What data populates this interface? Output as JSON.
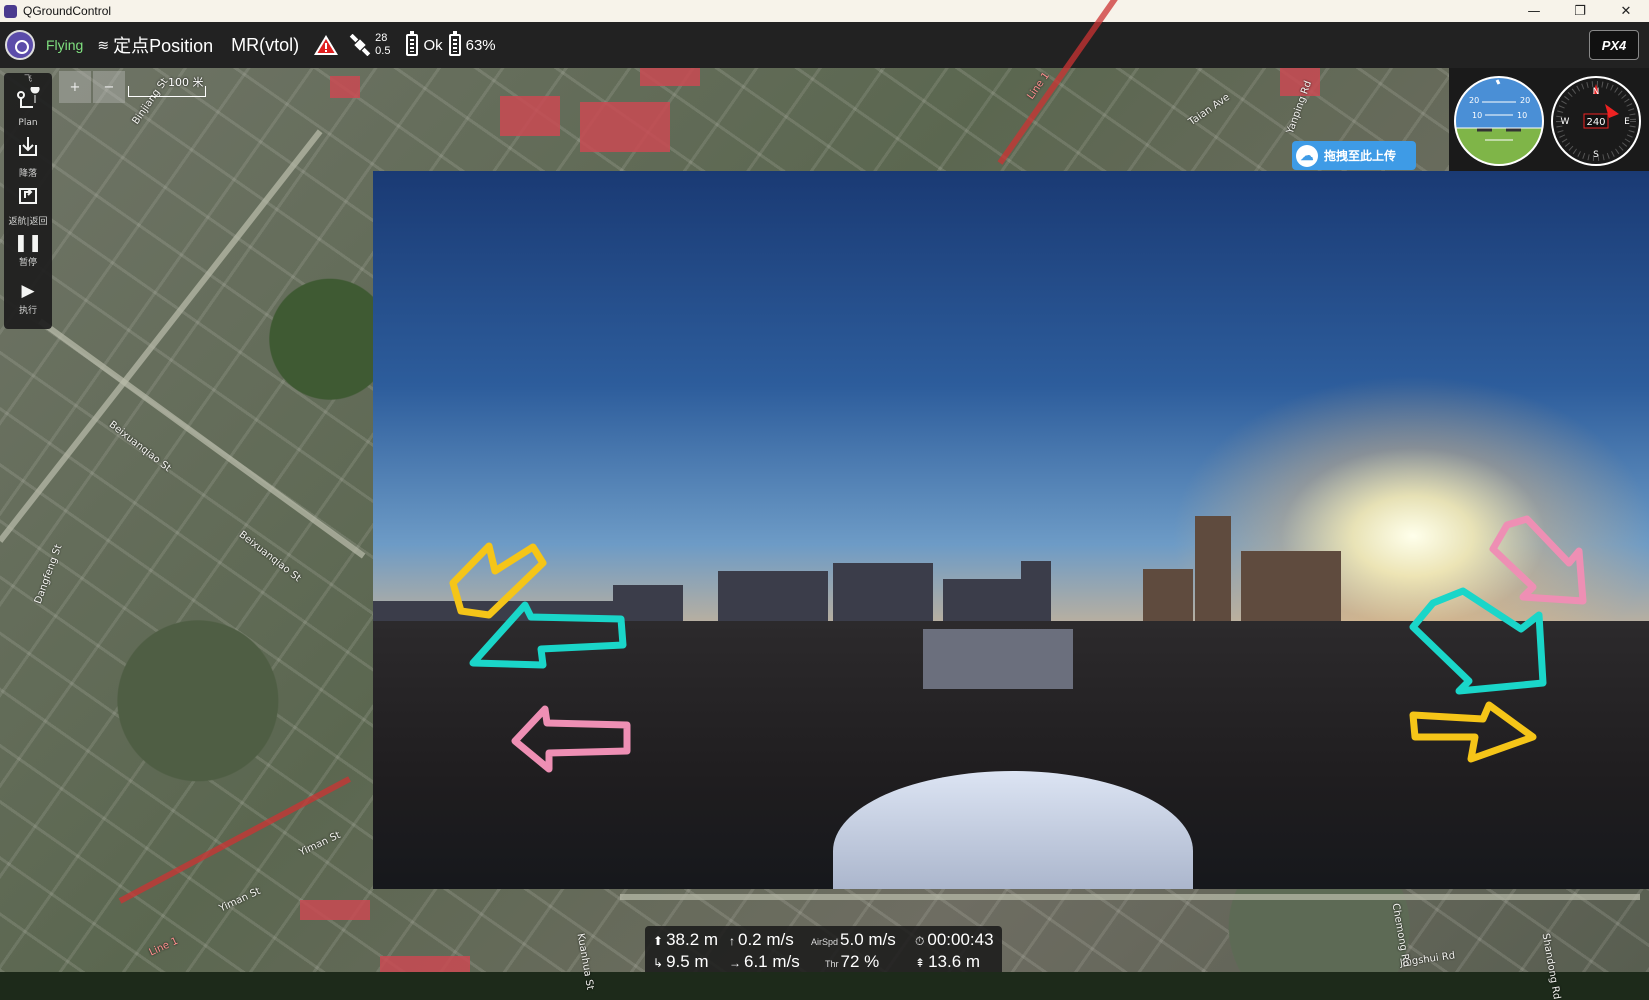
{
  "window": {
    "title": "QGroundControl",
    "minimize": "—",
    "restore": "❐",
    "close": "✕"
  },
  "toolbar": {
    "flight_state": "Flying",
    "flight_mode_icon": "signal-bars-icon",
    "flight_mode": "定点Position",
    "vehicle_type": "MR(vtol)",
    "gps_satellites": "28",
    "gps_hdop": "0.5",
    "status_ok": "Ok",
    "battery": "63%",
    "brand_logo": "PX4"
  },
  "fly_tools": {
    "header": "飞",
    "items": [
      {
        "icon": "plan-icon",
        "label": "Plan"
      },
      {
        "icon": "land-icon",
        "label": "降落"
      },
      {
        "icon": "rtl-icon",
        "label": "返航|返回"
      },
      {
        "icon": "pause-icon",
        "label": "暂停"
      },
      {
        "icon": "play-icon",
        "label": "执行"
      }
    ]
  },
  "map": {
    "scale_label": "100 米",
    "zoom_in": "+",
    "zoom_out": "−",
    "street_labels": [
      "Binjiang St",
      "Beixuanqiao St",
      "Beixuanqiao St",
      "Taian Ave",
      "Yanping Rd",
      "Yiman St",
      "Yiman St",
      "Dangfeng St",
      "Kuanhua St",
      "Jingshui Rd",
      "Line 1",
      "Line 1",
      "Shandong Rd",
      "Chemong Rd"
    ]
  },
  "upload_overlay": {
    "label": "拖拽至此上传"
  },
  "instruments": {
    "attitude_ticks": [
      "20",
      "10",
      "10",
      "20"
    ],
    "compass": {
      "north": "N",
      "east": "E",
      "south": "S",
      "west": "W",
      "heading": "240"
    }
  },
  "telemetry": {
    "altitude": "38.2 m",
    "vertical_speed": "0.2 m/s",
    "airspeed_label": "AirSpd",
    "airspeed": "5.0 m/s",
    "flight_time": "00:00:43",
    "distance": "9.5 m",
    "ground_speed": "6.1 m/s",
    "throttle_label": "Thr",
    "throttle": "72 %",
    "distance_home": "13.6 m"
  },
  "colors": {
    "toolbar": "#222222",
    "flying": "#7fe07f",
    "accent_upload": "#3e9be6",
    "arrow_yellow": "#f5c518",
    "arrow_cyan": "#1ad6c9",
    "arrow_pink": "#ee8fb4"
  }
}
